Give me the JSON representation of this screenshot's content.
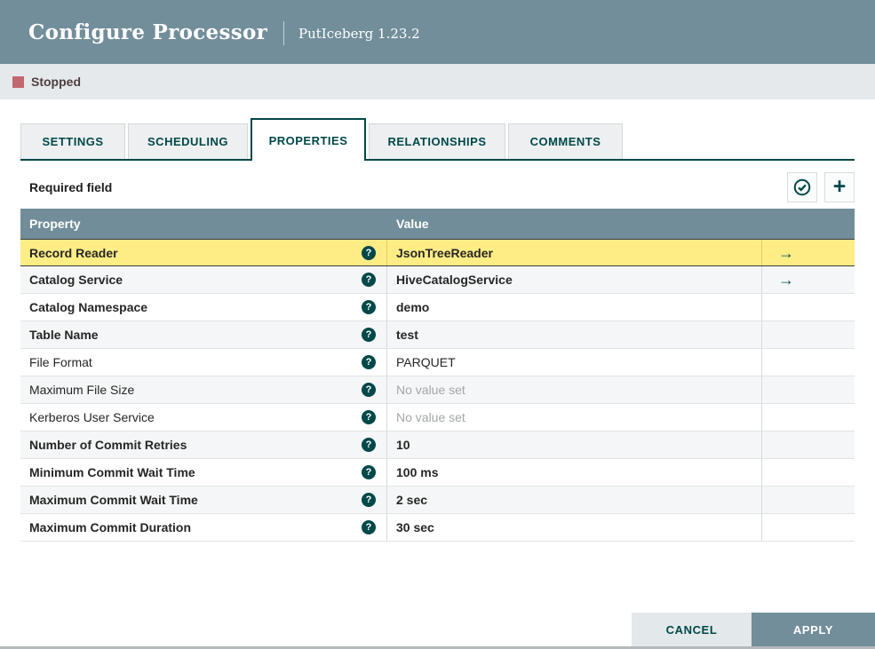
{
  "header": {
    "title": "Configure Processor",
    "subtitle": "PutIceberg 1.23.2"
  },
  "status_bar": {
    "label": "Stopped",
    "icon_color": "#c26871"
  },
  "tabs": [
    {
      "label": "SETTINGS",
      "active": false
    },
    {
      "label": "SCHEDULING",
      "active": false
    },
    {
      "label": "PROPERTIES",
      "active": true
    },
    {
      "label": "RELATIONSHIPS",
      "active": false
    },
    {
      "label": "COMMENTS",
      "active": false
    }
  ],
  "toolbar": {
    "required_label": "Required field",
    "verify_icon": "check-circle",
    "add_icon": "+"
  },
  "table": {
    "columns": [
      "Property",
      "Value"
    ],
    "help_glyph": "?",
    "arrow_glyph": "→",
    "rows": [
      {
        "property": "Record Reader",
        "value": "JsonTreeReader",
        "required": true,
        "selected": true,
        "arrow": true,
        "placeholder": false
      },
      {
        "property": "Catalog Service",
        "value": "HiveCatalogService",
        "required": true,
        "selected": false,
        "arrow": true,
        "placeholder": false
      },
      {
        "property": "Catalog Namespace",
        "value": "demo",
        "required": true,
        "selected": false,
        "arrow": false,
        "placeholder": false
      },
      {
        "property": "Table Name",
        "value": "test",
        "required": true,
        "selected": false,
        "arrow": false,
        "placeholder": false
      },
      {
        "property": "File Format",
        "value": "PARQUET",
        "required": false,
        "selected": false,
        "arrow": false,
        "placeholder": false
      },
      {
        "property": "Maximum File Size",
        "value": "No value set",
        "required": false,
        "selected": false,
        "arrow": false,
        "placeholder": true
      },
      {
        "property": "Kerberos User Service",
        "value": "No value set",
        "required": false,
        "selected": false,
        "arrow": false,
        "placeholder": true
      },
      {
        "property": "Number of Commit Retries",
        "value": "10",
        "required": true,
        "selected": false,
        "arrow": false,
        "placeholder": false
      },
      {
        "property": "Minimum Commit Wait Time",
        "value": "100 ms",
        "required": true,
        "selected": false,
        "arrow": false,
        "placeholder": false
      },
      {
        "property": "Maximum Commit Wait Time",
        "value": "2 sec",
        "required": true,
        "selected": false,
        "arrow": false,
        "placeholder": false
      },
      {
        "property": "Maximum Commit Duration",
        "value": "30 sec",
        "required": true,
        "selected": false,
        "arrow": false,
        "placeholder": false
      }
    ]
  },
  "footer": {
    "cancel_label": "CANCEL",
    "apply_label": "APPLY"
  },
  "colors": {
    "slate": "#728e9b",
    "teal": "#004849",
    "selected_row_yellow": "#feec85",
    "stopped_red": "#c26871"
  }
}
